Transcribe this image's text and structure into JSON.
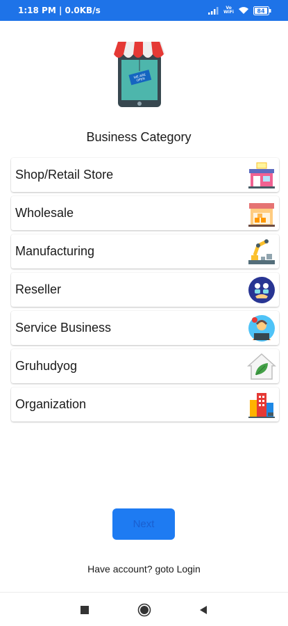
{
  "status_bar": {
    "time_speed": "1:18 PM | 0.0KB/s",
    "vo_top": "Vo",
    "vo_bottom": "WiFi",
    "battery": "84",
    "color": "#1e73e8"
  },
  "heading": "Business Category",
  "categories": [
    {
      "label": "Shop/Retail Store",
      "icon": "shop-store-icon"
    },
    {
      "label": "Wholesale",
      "icon": "wholesale-warehouse-icon"
    },
    {
      "label": "Manufacturing",
      "icon": "robot-arm-factory-icon"
    },
    {
      "label": "Reseller",
      "icon": "reseller-people-icon"
    },
    {
      "label": "Service Business",
      "icon": "service-support-agent-icon"
    },
    {
      "label": "Gruhudyog",
      "icon": "home-leaf-icon"
    },
    {
      "label": "Organization",
      "icon": "office-buildings-icon"
    }
  ],
  "next_button": {
    "label": "Next",
    "color": "#1e7bf2"
  },
  "login": {
    "text": "Have account? goto Login"
  },
  "nav": {
    "recents": "square-icon",
    "home": "circle-icon",
    "back": "triangle-back-icon"
  }
}
